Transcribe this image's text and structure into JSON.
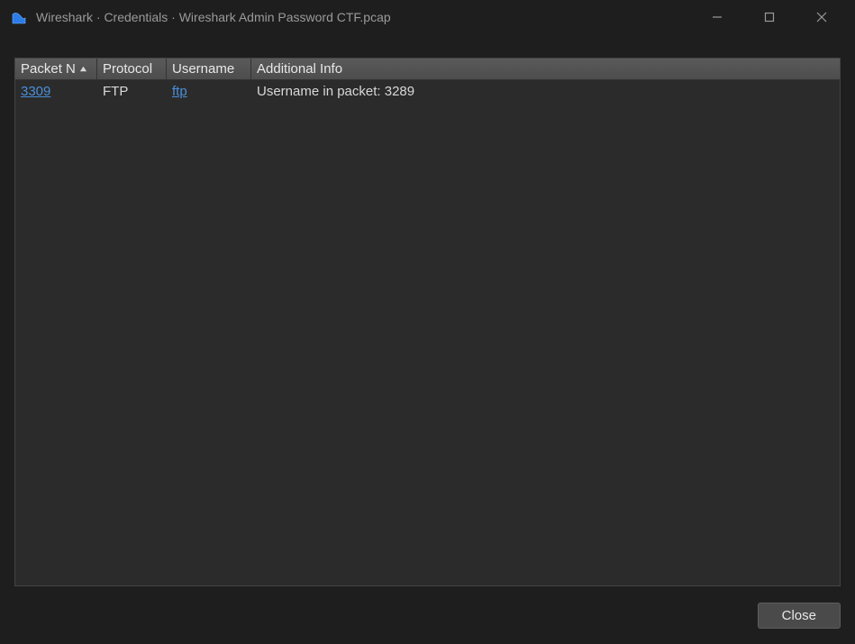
{
  "titlebar": {
    "title": "Wireshark · Credentials · Wireshark Admin Password CTF.pcap"
  },
  "table": {
    "headers": {
      "packet": "Packet N",
      "protocol": "Protocol",
      "username": "Username",
      "info": "Additional Info"
    },
    "rows": [
      {
        "packet": "3309",
        "protocol": "FTP",
        "username": "ftp",
        "info": "Username in packet: 3289"
      }
    ]
  },
  "footer": {
    "close_label": "Close"
  }
}
